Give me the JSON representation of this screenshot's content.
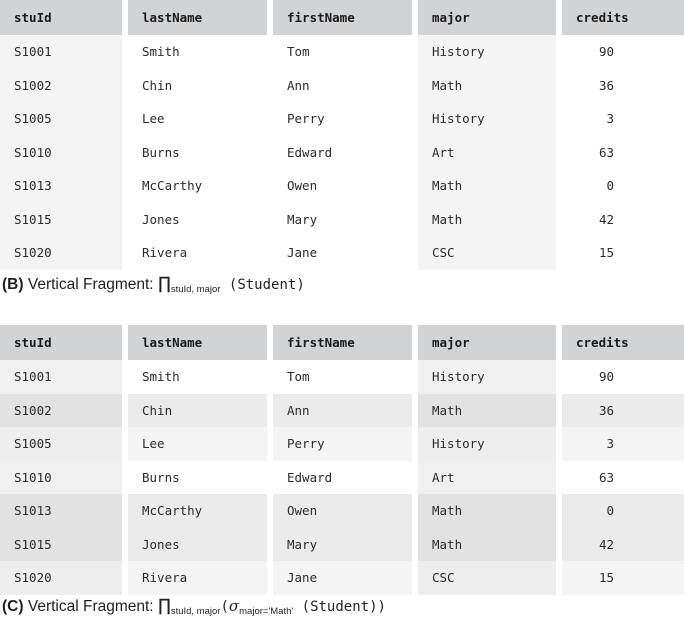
{
  "columns": [
    "stuId",
    "lastName",
    "firstName",
    "major",
    "credits"
  ],
  "rows": [
    {
      "stuId": "S1001",
      "lastName": "Smith",
      "firstName": "Tom",
      "major": "History",
      "credits": "90"
    },
    {
      "stuId": "S1002",
      "lastName": "Chin",
      "firstName": "Ann",
      "major": "Math",
      "credits": "36"
    },
    {
      "stuId": "S1005",
      "lastName": "Lee",
      "firstName": "Perry",
      "major": "History",
      "credits": "3"
    },
    {
      "stuId": "S1010",
      "lastName": "Burns",
      "firstName": "Edward",
      "major": "Art",
      "credits": "63"
    },
    {
      "stuId": "S1013",
      "lastName": "McCarthy",
      "firstName": "Owen",
      "major": "Math",
      "credits": "0"
    },
    {
      "stuId": "S1015",
      "lastName": "Jones",
      "firstName": "Mary",
      "major": "Math",
      "credits": "42"
    },
    {
      "stuId": "S1020",
      "lastName": "Rivera",
      "firstName": "Jane",
      "major": "CSC",
      "credits": "15"
    }
  ],
  "figure_b": {
    "label": "(B)",
    "text": "Vertical Fragment:",
    "pi": "∏",
    "pi_subscript": "stuId, major",
    "operand": "(Student)"
  },
  "figure_c": {
    "label": "(C)",
    "text": "Vertical Fragment:",
    "pi": "∏",
    "pi_subscript": "stuId, major",
    "open_paren": "(",
    "sigma": "σ",
    "sigma_subscript": "major='Math'",
    "operand": "(Student))"
  },
  "colors": {
    "header_bg": "#d2d3d5",
    "page_bg": "#ffffff",
    "column_highlight": "#f4f4f4",
    "row_selected": "#ebebeb",
    "text": "#2b2b2f",
    "header_text": "#1a1a1a"
  }
}
